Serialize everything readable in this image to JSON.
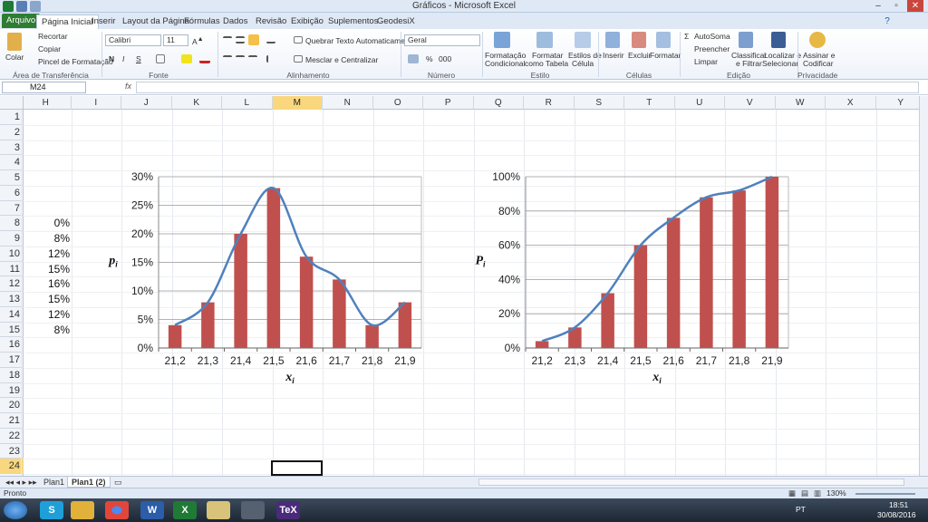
{
  "window": {
    "title": "Gráficos - Microsoft Excel"
  },
  "ribbon_tabs": [
    "Arquivo",
    "Página Inicial",
    "Inserir",
    "Layout da Página",
    "Fórmulas",
    "Dados",
    "Revisão",
    "Exibição",
    "Suplementos",
    "GeodesiX"
  ],
  "ribbon": {
    "clipboard": {
      "paste": "Colar",
      "cut": "Recortar",
      "copy": "Copiar",
      "format_painter": "Pincel de Formatação",
      "label": "Área de Transferência"
    },
    "font": {
      "name": "Calibri",
      "size": "11",
      "label": "Fonte",
      "bold": "N",
      "italic": "I",
      "underline": "S"
    },
    "alignment": {
      "wrap": "Quebrar Texto Automaticamente",
      "merge": "Mesclar e Centralizar",
      "label": "Alinhamento"
    },
    "number": {
      "format": "Geral",
      "label": "Número",
      "percent": "%",
      "thousands": "000"
    },
    "styles": {
      "cond": "Formatação\nCondicional",
      "cond_l1": "Formatação",
      "cond_l2": "Condicional",
      "table_l1": "Formatar",
      "table_l2": "como Tabela",
      "cell_l1": "Estilos de",
      "cell_l2": "Célula",
      "label": "Estilo"
    },
    "cells": {
      "insert": "Inserir",
      "delete": "Excluir",
      "format": "Formatar",
      "label": "Células"
    },
    "editing": {
      "autosum": "AutoSoma",
      "fill": "Preencher",
      "clear": "Limpar",
      "sort_l1": "Classificar",
      "sort_l2": "e Filtrar",
      "find_l1": "Localizar e",
      "find_l2": "Selecionar",
      "label": "Edição"
    },
    "privacy": {
      "sign_l1": "Assinar e",
      "sign_l2": "Codificar",
      "label": "Privacidade"
    }
  },
  "formula_bar": {
    "name_box": "M24",
    "fx": "fx",
    "content": ""
  },
  "columns": [
    "H",
    "I",
    "J",
    "K",
    "L",
    "M",
    "N",
    "O",
    "P",
    "Q",
    "R",
    "S",
    "T",
    "U",
    "V",
    "W",
    "X",
    "Y"
  ],
  "selected_column": "M",
  "rows": [
    "1",
    "2",
    "3",
    "4",
    "5",
    "6",
    "7",
    "8",
    "9",
    "10",
    "11",
    "12",
    "13",
    "14",
    "15",
    "16",
    "17",
    "18",
    "19",
    "20",
    "21",
    "22",
    "23",
    "24"
  ],
  "selected_row": "24",
  "column_h_values": [
    "0%",
    "8%",
    "12%",
    "15%",
    "16%",
    "15%",
    "12%",
    "8%"
  ],
  "chart_data": [
    {
      "type": "bar",
      "categories": [
        "21,2",
        "21,3",
        "21,4",
        "21,5",
        "21,6",
        "21,7",
        "21,8",
        "21,9"
      ],
      "series": [
        {
          "values": [
            4,
            8,
            20,
            28,
            16,
            12,
            4,
            8
          ],
          "color": "#c0504d",
          "kind": "bar"
        },
        {
          "values": [
            4,
            8,
            20,
            28,
            16,
            12,
            4,
            8
          ],
          "color": "#4f81bd",
          "kind": "smooth-line"
        }
      ],
      "yticks": [
        "0%",
        "5%",
        "10%",
        "15%",
        "20%",
        "25%",
        "30%"
      ],
      "ylim": [
        0,
        30
      ],
      "xlabel_main": "x",
      "xlabel_sub": "i",
      "ylabel_main": "p",
      "ylabel_sub": "i",
      "grid": true
    },
    {
      "type": "bar",
      "categories": [
        "21,2",
        "21,3",
        "21,4",
        "21,5",
        "21,6",
        "21,7",
        "21,8",
        "21,9"
      ],
      "series": [
        {
          "values": [
            4,
            12,
            32,
            60,
            76,
            88,
            92,
            100
          ],
          "color": "#c0504d",
          "kind": "bar"
        },
        {
          "values": [
            4,
            12,
            32,
            60,
            76,
            88,
            92,
            100
          ],
          "color": "#4f81bd",
          "kind": "smooth-line"
        }
      ],
      "yticks": [
        "0%",
        "20%",
        "40%",
        "60%",
        "80%",
        "100%"
      ],
      "ylim": [
        0,
        100
      ],
      "xlabel_main": "x",
      "xlabel_sub": "i",
      "ylabel_main": "P",
      "ylabel_sub": "i",
      "grid": true
    }
  ],
  "sheets": [
    "Plan1",
    "Plan1 (2)"
  ],
  "active_sheet": "Plan1 (2)",
  "status": {
    "ready": "Pronto",
    "zoom": "130%"
  },
  "taskbar": {
    "lang": "PT",
    "time": "18:51",
    "date": "30/08/2016"
  }
}
